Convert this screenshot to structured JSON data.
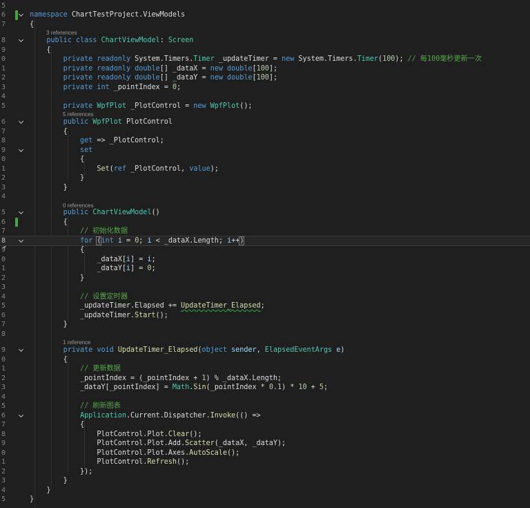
{
  "editor": {
    "line_numbers": [
      "5",
      "6",
      "7",
      "",
      "8",
      "9",
      "0",
      "1",
      "2",
      "3",
      "4",
      "5",
      "",
      "6",
      "7",
      "8",
      "9",
      "0",
      "1",
      "2",
      "3",
      "4",
      "",
      "5",
      "6",
      "7",
      "8",
      "9",
      "0",
      "1",
      "2",
      "3",
      "4",
      "5",
      "6",
      "7",
      "8",
      "",
      "9",
      "0",
      "1",
      "2",
      "3",
      "4",
      "5",
      "6",
      "7",
      "8",
      "9",
      "0",
      "1",
      "2",
      "3",
      "4",
      "5"
    ],
    "current_line_number": "8",
    "references": {
      "class": "3 references",
      "plotcontrol": "5 references",
      "ctor": "0 references",
      "handler": "1 reference"
    },
    "lines": [
      "",
      "namespace ChartTestProject.ViewModels",
      "{",
      "    public class ChartViewModel: Screen",
      "    {",
      "        private readonly System.Timers.Timer _updateTimer = new System.Timers.Timer(100); // 每100毫秒更新一次",
      "        private readonly double[] _dataX = new double[100];",
      "        private readonly double[] _dataY = new double[100];",
      "        private int _pointIndex = 0;",
      "",
      "        private WpfPlot _PlotControl = new WpfPlot();",
      "        public WpfPlot PlotControl",
      "        {",
      "            get => _PlotControl;",
      "            set",
      "            {",
      "                Set(ref _PlotControl, value);",
      "            }",
      "        }",
      "",
      "        public ChartViewModel()",
      "        {",
      "            // 初始化数据",
      "            for (int i = 0; i < _dataX.Length; i++)",
      "            {",
      "                _dataX[i] = i;",
      "                _dataY[i] = 0;",
      "            }",
      "",
      "            // 设置定时器",
      "            _updateTimer.Elapsed += UpdateTimer_Elapsed;",
      "            _updateTimer.Start();",
      "        }",
      "",
      "        private void UpdateTimer_Elapsed(object sender, ElapsedEventArgs e)",
      "        {",
      "            // 更新数据",
      "            _pointIndex = (_pointIndex + 1) % _dataX.Length;",
      "            _dataY[_pointIndex] = Math.Sin(_pointIndex * 0.1) * 10 + 5;",
      "",
      "            // 刷新图表",
      "            Application.Current.Dispatcher.Invoke(() =>",
      "            {",
      "                PlotControl.Plot.Clear();",
      "                PlotControl.Plot.Add.Scatter(_dataX, _dataY);",
      "                PlotControl.Plot.Axes.AutoScale();",
      "                PlotControl.Refresh();",
      "            });",
      "        }",
      "    }",
      "}"
    ]
  }
}
